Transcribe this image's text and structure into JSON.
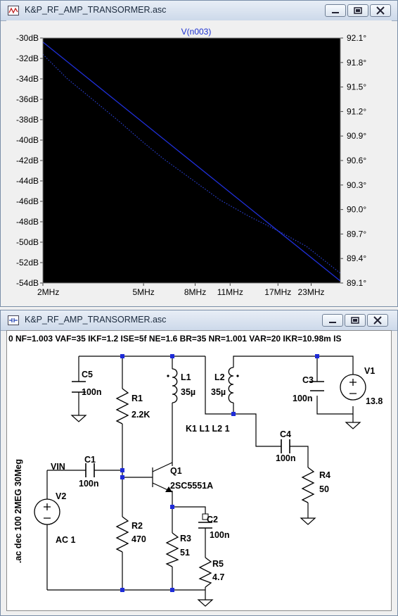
{
  "plot_window": {
    "title": "K&P_RF_AMP_TRANSORMER.asc",
    "trace_label": "V(n003)"
  },
  "schematic_window": {
    "title": "K&P_RF_AMP_TRANSORMER.asc",
    "model_text": "0 NF=1.003 VAF=35 IKF=1.2 ISE=5f NE=1.6 BR=35 NR=1.001 VAR=20 IKR=10.98m IS",
    "directive": ".ac dec 100 2MEG 30Meg",
    "coupling": "K1 L1 L2 1",
    "net_label": "VIN",
    "components": [
      {
        "ref": "C5",
        "value": "100n"
      },
      {
        "ref": "R1",
        "value": "2.2K"
      },
      {
        "ref": "L1",
        "value": "35µ"
      },
      {
        "ref": "L2",
        "value": "35µ"
      },
      {
        "ref": "C3",
        "value": "100n"
      },
      {
        "ref": "V1",
        "value": "13.8"
      },
      {
        "ref": "C1",
        "value": "100n"
      },
      {
        "ref": "Q1",
        "value": "2SC5551A"
      },
      {
        "ref": "C4",
        "value": "100n"
      },
      {
        "ref": "R4",
        "value": "50"
      },
      {
        "ref": "V2",
        "value": "AC 1"
      },
      {
        "ref": "R2",
        "value": "470"
      },
      {
        "ref": "R3",
        "value": "51"
      },
      {
        "ref": "C2",
        "value": "100n"
      },
      {
        "ref": "R5",
        "value": "4.7"
      }
    ]
  },
  "chart_data": {
    "type": "line",
    "title": "V(n003)",
    "x_scale": "log",
    "xlim_hz": [
      2000000,
      30000000
    ],
    "x_ticks": [
      {
        "label": "2MHz",
        "value": 2000000
      },
      {
        "label": "5MHz",
        "value": 5000000
      },
      {
        "label": "8MHz",
        "value": 8000000
      },
      {
        "label": "11MHz",
        "value": 11000000
      },
      {
        "label": "17MHz",
        "value": 17000000
      },
      {
        "label": "23MHz",
        "value": 23000000
      }
    ],
    "ylim_db": [
      -54,
      -30
    ],
    "y_left_ticks": [
      "-30dB",
      "-32dB",
      "-34dB",
      "-36dB",
      "-38dB",
      "-40dB",
      "-42dB",
      "-44dB",
      "-46dB",
      "-48dB",
      "-50dB",
      "-52dB",
      "-54dB"
    ],
    "ylim_deg": [
      89.1,
      92.1
    ],
    "y_right_ticks": [
      "92.1°",
      "91.8°",
      "91.5°",
      "91.2°",
      "90.9°",
      "90.6°",
      "90.3°",
      "90.0°",
      "89.7°",
      "89.4°",
      "89.1°"
    ],
    "grid": false,
    "series": [
      {
        "role": "magnitude",
        "unit": "dB",
        "color": "#1f2fd8",
        "style": "solid",
        "x": [
          2000000,
          30000000
        ],
        "y": [
          -30.4,
          -53.8
        ]
      },
      {
        "role": "phase",
        "unit": "deg",
        "color": "#2a3fcf",
        "style": "dotted",
        "x": [
          2000000,
          2500000,
          3000000,
          4000000,
          5000000,
          6000000,
          8000000,
          10000000,
          13000000,
          17000000,
          22000000,
          30000000
        ],
        "y": [
          91.9,
          91.6,
          91.4,
          91.08,
          90.82,
          90.62,
          90.34,
          90.12,
          89.92,
          89.74,
          89.55,
          89.22
        ]
      }
    ]
  }
}
